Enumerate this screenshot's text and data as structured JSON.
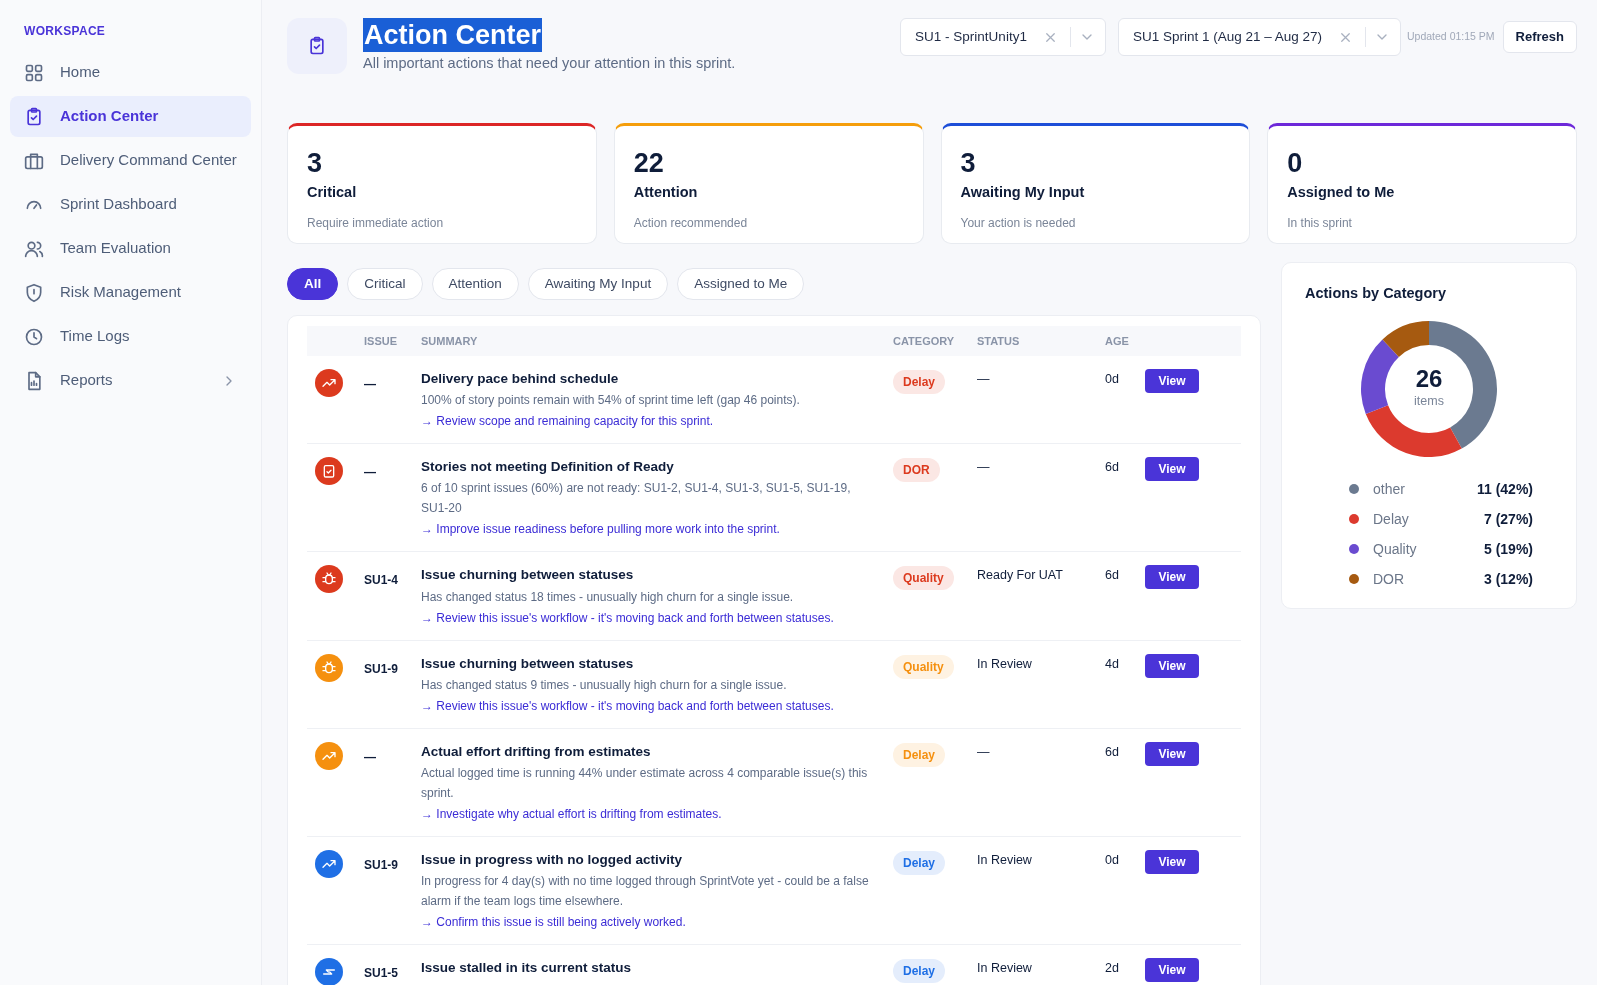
{
  "sidebar": {
    "section_title": "WORKSPACE",
    "items": [
      {
        "kind": "grid",
        "label": "Home",
        "selected": false
      },
      {
        "kind": "clipboard",
        "label": "Action Center",
        "selected": true
      },
      {
        "kind": "briefcase",
        "label": "Delivery Command Center",
        "selected": false
      },
      {
        "kind": "gauge",
        "label": "Sprint Dashboard",
        "selected": false
      },
      {
        "kind": "users",
        "label": "Team Evaluation",
        "selected": false
      },
      {
        "kind": "shield",
        "label": "Risk Management",
        "selected": false
      },
      {
        "kind": "clock",
        "label": "Time Logs",
        "selected": false
      },
      {
        "kind": "file",
        "label": "Reports",
        "selected": false,
        "expanded": false
      }
    ]
  },
  "header": {
    "title": "Action Center",
    "title_highlighted": true,
    "subtitle": "All important actions that need your attention in this sprint.",
    "selects": [
      {
        "value": "SU1 - SprintUnity1"
      },
      {
        "value": "SU1 Sprint 1 (Aug 21 – Aug 27)"
      }
    ],
    "updated": "Updated 01:15 PM",
    "refresh_button": "Refresh"
  },
  "summary_cards": [
    {
      "count": "3",
      "title": "Critical",
      "subtitle": "Require immediate action",
      "color": "#dc2626"
    },
    {
      "count": "22",
      "title": "Attention",
      "subtitle": "Action recommended",
      "color": "#f59e0b"
    },
    {
      "count": "3",
      "title": "Awaiting My Input",
      "subtitle": "Your action is needed",
      "color": "#1d4ed8"
    },
    {
      "count": "0",
      "title": "Assigned to Me",
      "subtitle": "In this sprint",
      "color": "#6d28d9"
    }
  ],
  "filters": [
    {
      "label": "All",
      "selected": true
    },
    {
      "label": "Critical",
      "selected": false
    },
    {
      "label": "Attention",
      "selected": false
    },
    {
      "label": "Awaiting My Input",
      "selected": false
    },
    {
      "label": "Assigned to Me",
      "selected": false
    }
  ],
  "table": {
    "columns": [
      "ISSUE",
      "SUMMARY",
      "CATEGORY",
      "STATUS",
      "AGE"
    ],
    "rows": [
      {
        "kind": "trend",
        "color": "#dc3a1e",
        "issue": "—",
        "title": "Delivery pace behind schedule",
        "description": "100% of story points remain with 54% of sprint time left (gap 46 points).",
        "action": "→ Review scope and remaining capacity for this sprint.",
        "category": "Delay",
        "status": "—",
        "age": "0d",
        "button": "View"
      },
      {
        "kind": "clipboard",
        "color": "#dc3a1e",
        "issue": "—",
        "title": "Stories not meeting Definition of Ready",
        "description": "6 of 10 sprint issues (60%) are not ready: SU1-2, SU1-4, SU1-3, SU1-5, SU1-19, SU1-20",
        "action": "→ Improve issue readiness before pulling more work into the sprint.",
        "category": "DOR",
        "status": "—",
        "age": "6d",
        "button": "View"
      },
      {
        "kind": "bug",
        "color": "#dc3a1e",
        "issue": "SU1-4",
        "title": "Issue churning between statuses",
        "description": "Has changed status 18 times - unusually high churn for a single issue.",
        "action": "→ Review this issue's workflow - it's moving back and forth between statuses.",
        "category": "Quality",
        "status": "Ready For UAT",
        "age": "6d",
        "button": "View"
      },
      {
        "kind": "bug",
        "color": "#f5900f",
        "issue": "SU1-9",
        "title": "Issue churning between statuses",
        "description": "Has changed status 9 times - unusually high churn for a single issue.",
        "action": "→ Review this issue's workflow - it's moving back and forth between statuses.",
        "category": "Quality",
        "status": "In Review",
        "age": "4d",
        "button": "View"
      },
      {
        "kind": "trend",
        "color": "#f5900f",
        "issue": "—",
        "title": "Actual effort drifting from estimates",
        "description": "Actual logged time is running 44% under estimate across 4 comparable issue(s) this sprint.",
        "action": "→ Investigate why actual effort is drifting from estimates.",
        "category": "Delay",
        "status": "—",
        "age": "6d",
        "button": "View"
      },
      {
        "kind": "trend",
        "color": "#1f6fe5",
        "issue": "SU1-9",
        "title": "Issue in progress with no logged activity",
        "description": "In progress for 4 day(s) with no time logged through SprintVote yet - could be a false alarm if the team logs time elsewhere.",
        "action": "→ Confirm this issue is still being actively worked.",
        "category": "Delay",
        "status": "In Review",
        "age": "0d",
        "button": "View"
      },
      {
        "kind": "move",
        "color": "#1f6fe5",
        "issue": "SU1-5",
        "title": "Issue stalled in its current status",
        "category": "Delay",
        "status": "In Review",
        "age": "2d",
        "button": "View"
      }
    ]
  },
  "category_panel": {
    "title": "Actions by Category",
    "total": "26",
    "total_label": "items",
    "chart_data": {
      "type": "donut",
      "categories": [
        "other",
        "Delay",
        "Quality",
        "DOR"
      ],
      "values": [
        42,
        27,
        19,
        12
      ],
      "value_labels": [
        "11 (42%)",
        "7 (27%)",
        "5 (19%)",
        "3 (12%)"
      ],
      "colors": [
        "#6b7a90",
        "#dc3a2e",
        "#6a4bd0",
        "#a65a10"
      ]
    }
  }
}
